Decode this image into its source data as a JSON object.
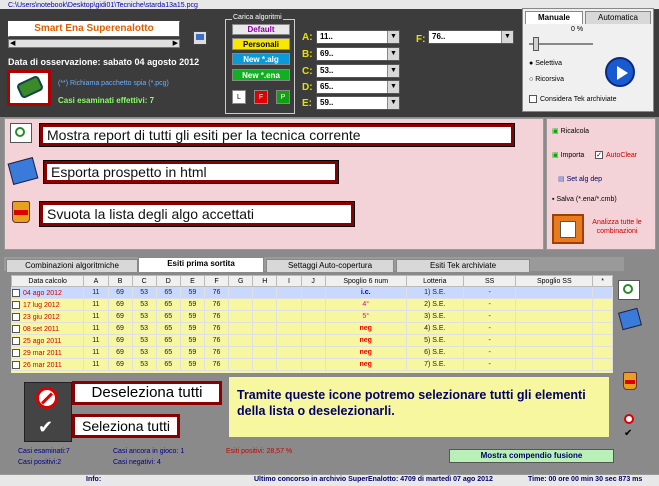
{
  "window": {
    "path": "C:\\Users\\notebook\\Desktop\\gidi01\\Tecniche\\starda13a15.pcg"
  },
  "app": {
    "title": "Smart Ena Superenalotto"
  },
  "observation": {
    "label": "Data di osservazione:",
    "value": "sabato 04 agosto 2012"
  },
  "spy": {
    "text": "(**) Richiama pacchetto spia (*.pcg)"
  },
  "cases": {
    "label": "Casi esaminati effettivi: 7"
  },
  "loader": {
    "group_title": "Carica algoritmi",
    "default": "Default",
    "personali": "Personali",
    "new_alg": "New *.alg",
    "new_ena": "New *.ena",
    "btn_l": "L",
    "btn_f": "F",
    "btn_p": "P"
  },
  "fields": [
    {
      "letter": "A:",
      "value": "11.."
    },
    {
      "letter": "B:",
      "value": "69.."
    },
    {
      "letter": "C:",
      "value": "53.."
    },
    {
      "letter": "D:",
      "value": "65.."
    },
    {
      "letter": "E:",
      "value": "59.."
    }
  ],
  "field_f": {
    "letter": "F:",
    "value": "76.."
  },
  "panel": {
    "tab_manual": "Manuale",
    "tab_auto": "Automatica",
    "percent": "0 %",
    "radio1": "Selettiva",
    "radio2": "Ricorsiva",
    "check": "Considera Tek archiviate"
  },
  "actions": {
    "report": "Mostra report di tutti gli esiti per la tecnica corrente",
    "export": "Esporta prospetto in html",
    "clear": "Svuota la lista degli algo accettati"
  },
  "side": {
    "ricalcola": "Ricalcola",
    "importa": "Importa",
    "autoclear": "AutoClear",
    "setalg": "Set alg dep",
    "salva": "Salva (*.ena/*.cmb)",
    "analizza": "Analizza tutte le combinazioni"
  },
  "tabs": [
    "Combinazioni algoritmiche",
    "Esiti prima sortita",
    "Settaggi Auto-copertura",
    "Esiti Tek archiviate"
  ],
  "table": {
    "headers": [
      "Data calcolo",
      "A",
      "B",
      "C",
      "D",
      "E",
      "F",
      "G",
      "H",
      "I",
      "J",
      "Spoglio 6 num",
      "Lotteria",
      "SS",
      "Spoglio SS",
      "*"
    ],
    "rows": [
      [
        "04 ago 2012",
        "11",
        "69",
        "53",
        "65",
        "59",
        "76",
        "",
        "",
        "",
        "",
        "i.c.",
        "1) S.E.",
        "-",
        "",
        ""
      ],
      [
        "17 lug 2012",
        "11",
        "69",
        "53",
        "65",
        "59",
        "76",
        "",
        "",
        "",
        "",
        "4°",
        "2) S.E.",
        "-",
        "",
        ""
      ],
      [
        "23 giu 2012",
        "11",
        "69",
        "53",
        "65",
        "59",
        "76",
        "",
        "",
        "",
        "",
        "5°",
        "3) S.E.",
        "-",
        "",
        ""
      ],
      [
        "08 set 2011",
        "11",
        "69",
        "53",
        "65",
        "59",
        "76",
        "",
        "",
        "",
        "",
        "neg",
        "4) S.E.",
        "-",
        "",
        ""
      ],
      [
        "25 ago 2011",
        "11",
        "69",
        "53",
        "65",
        "59",
        "76",
        "",
        "",
        "",
        "",
        "neg",
        "5) S.E.",
        "-",
        "",
        ""
      ],
      [
        "29 mar 2011",
        "11",
        "69",
        "53",
        "65",
        "59",
        "76",
        "",
        "",
        "",
        "",
        "neg",
        "6) S.E.",
        "-",
        "",
        ""
      ],
      [
        "26 mar 2011",
        "11",
        "69",
        "53",
        "65",
        "59",
        "76",
        "",
        "",
        "",
        "",
        "neg",
        "7) S.E.",
        "-",
        "",
        ""
      ]
    ]
  },
  "overlay": {
    "deselect": "Deseleziona tutti",
    "select": "Seleziona tutti",
    "note": "Tramite queste icone potremo selezionare tutti gli elementi della lista o deselezionarli."
  },
  "stats": {
    "examined": "Casi esaminati:7",
    "positive": "Casi positivi:2",
    "ongoing": "Casi ancora in gioco: 1",
    "negative": "Casi negativi: 4",
    "pct": "Esiti positivi: 28,57 %",
    "fusion": "Mostra compendio fusione"
  },
  "status": {
    "info": "Info:",
    "last": "Ultimo concorso in archivio SuperEnalotto: 4709 di martedì 07 ago 2012",
    "time": "Time: 00 ore 00 min 30 sec 873 ms"
  }
}
